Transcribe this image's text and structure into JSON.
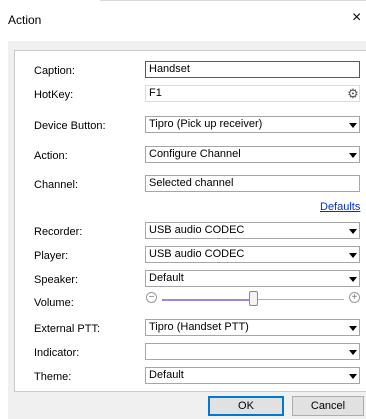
{
  "window": {
    "title": "Action",
    "close_glyph": "×"
  },
  "form": {
    "caption": {
      "label": "Caption:",
      "value": "Handset"
    },
    "hotkey": {
      "label": "HotKey:",
      "value": "F1",
      "icon": "gear-icon"
    },
    "device_button": {
      "label": "Device Button:",
      "value": "Tipro (Pick up receiver)"
    },
    "action": {
      "label": "Action:",
      "value": "Configure Channel"
    },
    "channel": {
      "label": "Channel:",
      "value": "Selected channel"
    },
    "defaults_link": "Defaults",
    "recorder": {
      "label": "Recorder:",
      "value": "USB audio CODEC"
    },
    "player": {
      "label": "Player:",
      "value": "USB audio CODEC"
    },
    "speaker": {
      "label": "Speaker:",
      "value": "Default"
    },
    "volume": {
      "label": "Volume:",
      "level_percent": 50
    },
    "external_ptt": {
      "label": "External PTT:",
      "value": "Tipro (Handset PTT)"
    },
    "indicator": {
      "label": "Indicator:",
      "value": ""
    },
    "theme": {
      "label": "Theme:",
      "value": "Default"
    }
  },
  "buttons": {
    "ok": "OK",
    "cancel": "Cancel"
  },
  "colors": {
    "link": "#0033cc",
    "default_button_border": "#0078d7",
    "slider": "#9c88d8"
  }
}
